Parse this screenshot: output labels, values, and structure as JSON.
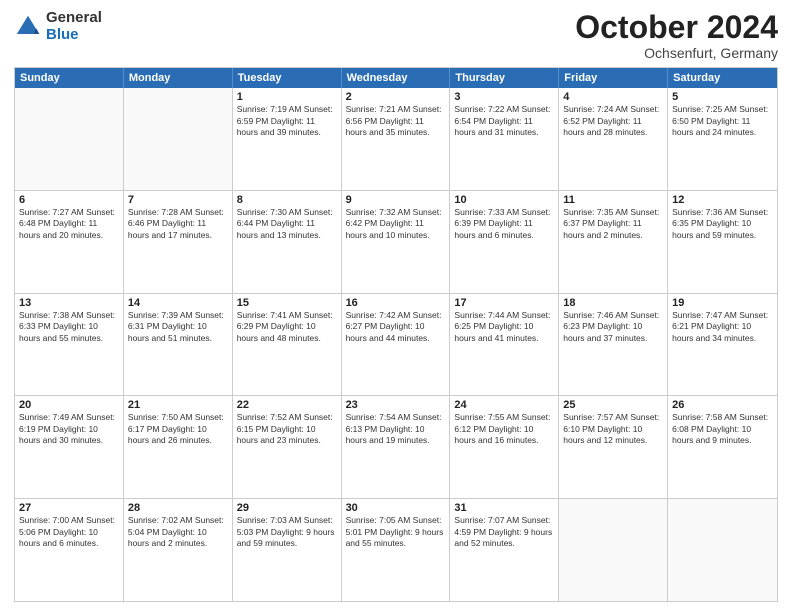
{
  "logo": {
    "general": "General",
    "blue": "Blue"
  },
  "header": {
    "month": "October 2024",
    "location": "Ochsenfurt, Germany"
  },
  "weekdays": [
    "Sunday",
    "Monday",
    "Tuesday",
    "Wednesday",
    "Thursday",
    "Friday",
    "Saturday"
  ],
  "rows": [
    [
      {
        "day": "",
        "text": ""
      },
      {
        "day": "",
        "text": ""
      },
      {
        "day": "1",
        "text": "Sunrise: 7:19 AM\nSunset: 6:59 PM\nDaylight: 11 hours and 39 minutes."
      },
      {
        "day": "2",
        "text": "Sunrise: 7:21 AM\nSunset: 6:56 PM\nDaylight: 11 hours and 35 minutes."
      },
      {
        "day": "3",
        "text": "Sunrise: 7:22 AM\nSunset: 6:54 PM\nDaylight: 11 hours and 31 minutes."
      },
      {
        "day": "4",
        "text": "Sunrise: 7:24 AM\nSunset: 6:52 PM\nDaylight: 11 hours and 28 minutes."
      },
      {
        "day": "5",
        "text": "Sunrise: 7:25 AM\nSunset: 6:50 PM\nDaylight: 11 hours and 24 minutes."
      }
    ],
    [
      {
        "day": "6",
        "text": "Sunrise: 7:27 AM\nSunset: 6:48 PM\nDaylight: 11 hours and 20 minutes."
      },
      {
        "day": "7",
        "text": "Sunrise: 7:28 AM\nSunset: 6:46 PM\nDaylight: 11 hours and 17 minutes."
      },
      {
        "day": "8",
        "text": "Sunrise: 7:30 AM\nSunset: 6:44 PM\nDaylight: 11 hours and 13 minutes."
      },
      {
        "day": "9",
        "text": "Sunrise: 7:32 AM\nSunset: 6:42 PM\nDaylight: 11 hours and 10 minutes."
      },
      {
        "day": "10",
        "text": "Sunrise: 7:33 AM\nSunset: 6:39 PM\nDaylight: 11 hours and 6 minutes."
      },
      {
        "day": "11",
        "text": "Sunrise: 7:35 AM\nSunset: 6:37 PM\nDaylight: 11 hours and 2 minutes."
      },
      {
        "day": "12",
        "text": "Sunrise: 7:36 AM\nSunset: 6:35 PM\nDaylight: 10 hours and 59 minutes."
      }
    ],
    [
      {
        "day": "13",
        "text": "Sunrise: 7:38 AM\nSunset: 6:33 PM\nDaylight: 10 hours and 55 minutes."
      },
      {
        "day": "14",
        "text": "Sunrise: 7:39 AM\nSunset: 6:31 PM\nDaylight: 10 hours and 51 minutes."
      },
      {
        "day": "15",
        "text": "Sunrise: 7:41 AM\nSunset: 6:29 PM\nDaylight: 10 hours and 48 minutes."
      },
      {
        "day": "16",
        "text": "Sunrise: 7:42 AM\nSunset: 6:27 PM\nDaylight: 10 hours and 44 minutes."
      },
      {
        "day": "17",
        "text": "Sunrise: 7:44 AM\nSunset: 6:25 PM\nDaylight: 10 hours and 41 minutes."
      },
      {
        "day": "18",
        "text": "Sunrise: 7:46 AM\nSunset: 6:23 PM\nDaylight: 10 hours and 37 minutes."
      },
      {
        "day": "19",
        "text": "Sunrise: 7:47 AM\nSunset: 6:21 PM\nDaylight: 10 hours and 34 minutes."
      }
    ],
    [
      {
        "day": "20",
        "text": "Sunrise: 7:49 AM\nSunset: 6:19 PM\nDaylight: 10 hours and 30 minutes."
      },
      {
        "day": "21",
        "text": "Sunrise: 7:50 AM\nSunset: 6:17 PM\nDaylight: 10 hours and 26 minutes."
      },
      {
        "day": "22",
        "text": "Sunrise: 7:52 AM\nSunset: 6:15 PM\nDaylight: 10 hours and 23 minutes."
      },
      {
        "day": "23",
        "text": "Sunrise: 7:54 AM\nSunset: 6:13 PM\nDaylight: 10 hours and 19 minutes."
      },
      {
        "day": "24",
        "text": "Sunrise: 7:55 AM\nSunset: 6:12 PM\nDaylight: 10 hours and 16 minutes."
      },
      {
        "day": "25",
        "text": "Sunrise: 7:57 AM\nSunset: 6:10 PM\nDaylight: 10 hours and 12 minutes."
      },
      {
        "day": "26",
        "text": "Sunrise: 7:58 AM\nSunset: 6:08 PM\nDaylight: 10 hours and 9 minutes."
      }
    ],
    [
      {
        "day": "27",
        "text": "Sunrise: 7:00 AM\nSunset: 5:06 PM\nDaylight: 10 hours and 6 minutes."
      },
      {
        "day": "28",
        "text": "Sunrise: 7:02 AM\nSunset: 5:04 PM\nDaylight: 10 hours and 2 minutes."
      },
      {
        "day": "29",
        "text": "Sunrise: 7:03 AM\nSunset: 5:03 PM\nDaylight: 9 hours and 59 minutes."
      },
      {
        "day": "30",
        "text": "Sunrise: 7:05 AM\nSunset: 5:01 PM\nDaylight: 9 hours and 55 minutes."
      },
      {
        "day": "31",
        "text": "Sunrise: 7:07 AM\nSunset: 4:59 PM\nDaylight: 9 hours and 52 minutes."
      },
      {
        "day": "",
        "text": ""
      },
      {
        "day": "",
        "text": ""
      }
    ]
  ]
}
